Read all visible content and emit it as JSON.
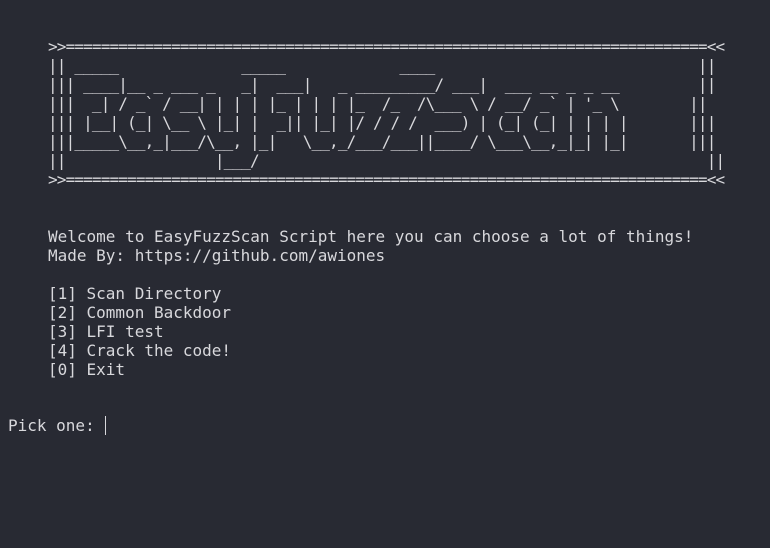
{
  "banner": {
    "lines": [
      ">>=========================================================================<<",
      "|| _____              _____             ____                              ||",
      "||| ____|__ _ ___ _   _|  ___|   _ _________/ ___|  ___ __ _ _ __         ||",
      "|||  _| / _` / __| | | | |_ | | | |_  /_  /\\___ \\ / __/ _` | '_ \\        ||",
      "||| |__| (_| \\__ \\ |_| |  _|| |_| |/ / / /  ___) | (_| (_| | | | |       |||",
      "|||_____\\__,_|___/\\__, |_|   \\__,_/___/___||____/ \\___\\__,_|_| |_|       |||",
      "||                 |___/                                                   ||",
      ">>=========================================================================<<"
    ]
  },
  "welcome": {
    "line1": "Welcome to EasyFuzzScan Script here you can choose a lot of things!",
    "line2": "Made By: https://github.com/awiones"
  },
  "menu": {
    "items": [
      "[1] Scan Directory",
      "[2] Common Backdoor",
      "[3] LFI test",
      "[4] Crack the code!",
      "[0] Exit"
    ]
  },
  "prompt": {
    "label": "Pick one:",
    "value": ""
  }
}
